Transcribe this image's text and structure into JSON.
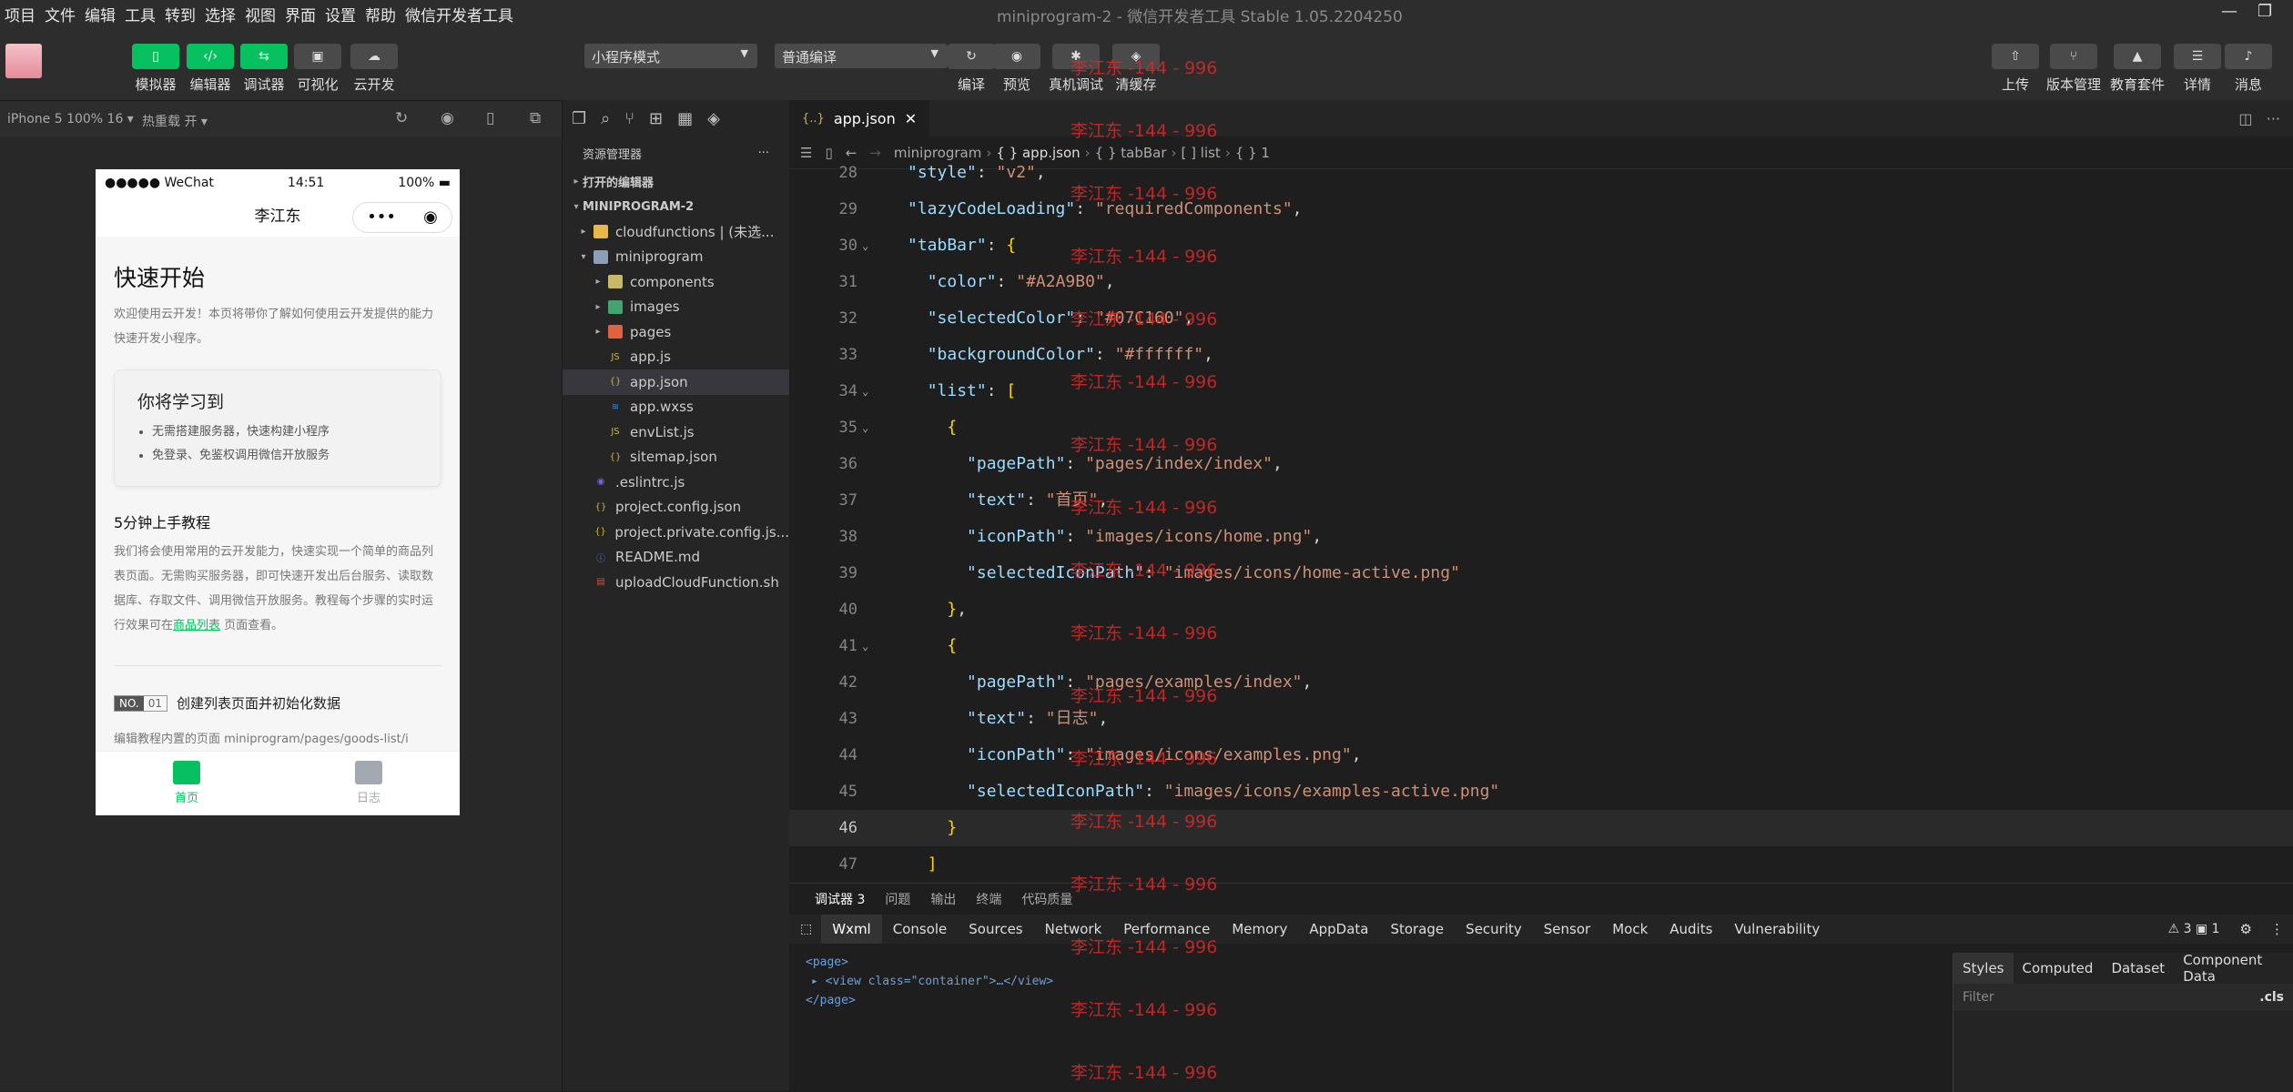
{
  "menu": [
    "项目",
    "文件",
    "编辑",
    "工具",
    "转到",
    "选择",
    "视图",
    "界面",
    "设置",
    "帮助",
    "微信开发者工具"
  ],
  "window_title": "miniprogram-2 - 微信开发者工具 Stable 1.05.2204250",
  "toolbar": {
    "left": [
      {
        "label": "模拟器",
        "icon": "phone-icon"
      },
      {
        "label": "编辑器",
        "icon": "code-icon"
      },
      {
        "label": "调试器",
        "icon": "debug-icon"
      },
      {
        "label": "可视化",
        "icon": "layout-icon"
      },
      {
        "label": "云开发",
        "icon": "cloud-icon"
      }
    ],
    "mode": "小程序模式",
    "compile": "普通编译",
    "mid": [
      {
        "label": "编译",
        "icon": "refresh-icon"
      },
      {
        "label": "预览",
        "icon": "eye-icon"
      },
      {
        "label": "真机调试",
        "icon": "bug-icon"
      },
      {
        "label": "清缓存",
        "icon": "layers-icon"
      }
    ],
    "right": [
      {
        "label": "上传",
        "icon": "upload-icon"
      },
      {
        "label": "版本管理",
        "icon": "branch-icon"
      },
      {
        "label": "教育套件",
        "icon": "graduation-icon"
      },
      {
        "label": "详情",
        "icon": "menu-icon"
      },
      {
        "label": "消息",
        "icon": "bell-icon"
      }
    ]
  },
  "simulator": {
    "device": "iPhone 5 100% 16 ▾",
    "hotreload": "热重载 开 ▾",
    "status": {
      "signal": "●●●●● WeChat",
      "time": "14:51",
      "battery": "100%"
    },
    "nav_title": "李江东",
    "page": {
      "title": "快速开始",
      "intro": "欢迎使用云开发！本页将带你了解如何使用云开发提供的能力快速开发小程序。",
      "card_title": "你将学习到",
      "card_items": [
        "无需搭建服务器，快速构建小程序",
        "免登录、免鉴权调用微信开放服务"
      ],
      "section_title": "5分钟上手教程",
      "section_text": "我们将会使用常用的云开发能力，快速实现一个简单的商品列表页面。无需购买服务器，即可快速开发出后台服务、读取数据库、存取文件、调用微信开放服务。教程每个步骤的实时运行效果可在",
      "section_link": "商品列表",
      "section_tail": " 页面查看。",
      "step_no": "NO.",
      "step_num": "01",
      "step_title": "创建列表页面并初始化数据",
      "step_desc": "编辑教程内置的页面 miniprogram/pages/goods-list/i"
    },
    "tabs": [
      {
        "label": "首页"
      },
      {
        "label": "日志"
      }
    ]
  },
  "explorer": {
    "title": "资源管理器",
    "section_open": "打开的编辑器",
    "section_project": "MINIPROGRAM-2",
    "items": [
      {
        "name": "cloudfunctions | (未选...",
        "indent": 1,
        "chev": "▸",
        "icon": "folder-icon",
        "color": "#e8b84a"
      },
      {
        "name": "miniprogram",
        "indent": 1,
        "chev": "▾",
        "icon": "folder-icon",
        "color": "#8aa0b8"
      },
      {
        "name": "components",
        "indent": 2,
        "chev": "▸",
        "icon": "folder-icon",
        "color": "#c7b86a"
      },
      {
        "name": "images",
        "indent": 2,
        "chev": "▸",
        "icon": "folder-icon",
        "color": "#45a36f"
      },
      {
        "name": "pages",
        "indent": 2,
        "chev": "▸",
        "icon": "folder-icon",
        "color": "#e0623e"
      },
      {
        "name": "app.js",
        "indent": 2,
        "chev": "",
        "icon": "js-icon",
        "color": "#cbb34a"
      },
      {
        "name": "app.json",
        "indent": 2,
        "chev": "",
        "icon": "json-icon",
        "color": "#cbb34a",
        "selected": true
      },
      {
        "name": "app.wxss",
        "indent": 2,
        "chev": "",
        "icon": "css-icon",
        "color": "#3c8fd8"
      },
      {
        "name": "envList.js",
        "indent": 2,
        "chev": "",
        "icon": "js-icon",
        "color": "#cbb34a"
      },
      {
        "name": "sitemap.json",
        "indent": 2,
        "chev": "",
        "icon": "json-icon",
        "color": "#cbb34a"
      },
      {
        "name": ".eslintrc.js",
        "indent": 1,
        "chev": "",
        "icon": "eslint-icon",
        "color": "#6e6ad8"
      },
      {
        "name": "project.config.json",
        "indent": 1,
        "chev": "",
        "icon": "json-icon",
        "color": "#cbb34a"
      },
      {
        "name": "project.private.config.js...",
        "indent": 1,
        "chev": "",
        "icon": "json-icon",
        "color": "#cbb34a"
      },
      {
        "name": "README.md",
        "indent": 1,
        "chev": "",
        "icon": "info-icon",
        "color": "#4a8fd8"
      },
      {
        "name": "uploadCloudFunction.sh",
        "indent": 1,
        "chev": "",
        "icon": "shell-icon",
        "color": "#d0503a"
      }
    ]
  },
  "editor": {
    "tab": "app.json",
    "breadcrumb": [
      "miniprogram",
      "{ } app.json",
      "{ } tabBar",
      "[ ] list",
      "{ } 1"
    ],
    "lines": [
      {
        "n": "28",
        "text": "\"style\": \"v2\","
      },
      {
        "n": "29",
        "text": "\"lazyCodeLoading\": \"requiredComponents\","
      },
      {
        "n": "30",
        "text": "\"tabBar\": {",
        "fold": true
      },
      {
        "n": "31",
        "text": "  \"color\": \"#A2A9B0\","
      },
      {
        "n": "32",
        "text": "  \"selectedColor\": \"#07C160\","
      },
      {
        "n": "33",
        "text": "  \"backgroundColor\": \"#ffffff\","
      },
      {
        "n": "34",
        "text": "  \"list\": [",
        "fold": true
      },
      {
        "n": "35",
        "text": "    {",
        "fold": true
      },
      {
        "n": "36",
        "text": "      \"pagePath\": \"pages/index/index\","
      },
      {
        "n": "37",
        "text": "      \"text\": \"首页\","
      },
      {
        "n": "38",
        "text": "      \"iconPath\": \"images/icons/home.png\","
      },
      {
        "n": "39",
        "text": "      \"selectedIconPath\": \"images/icons/home-active.png\""
      },
      {
        "n": "40",
        "text": "    },"
      },
      {
        "n": "41",
        "text": "    {",
        "fold": true
      },
      {
        "n": "42",
        "text": "      \"pagePath\": \"pages/examples/index\","
      },
      {
        "n": "43",
        "text": "      \"text\": \"日志\","
      },
      {
        "n": "44",
        "text": "      \"iconPath\": \"images/icons/examples.png\","
      },
      {
        "n": "45",
        "text": "      \"selectedIconPath\": \"images/icons/examples-active.png\""
      },
      {
        "n": "46",
        "text": "    }",
        "current": true
      },
      {
        "n": "47",
        "text": "  ]"
      }
    ],
    "watermark": "李江东 -144 - 996"
  },
  "devtools": {
    "top_tabs": [
      {
        "label": "调试器 3"
      },
      {
        "label": "问题"
      },
      {
        "label": "输出"
      },
      {
        "label": "终端"
      },
      {
        "label": "代码质量"
      }
    ],
    "tabs": [
      "Wxml",
      "Console",
      "Sources",
      "Network",
      "Performance",
      "Memory",
      "AppData",
      "Storage",
      "Security",
      "Sensor",
      "Mock",
      "Audits",
      "Vulnerability"
    ],
    "warnings": "⚠ 3  ▣ 1",
    "dom": [
      "<page>",
      "▸ <view class=\"container\">…</view>",
      "</page>"
    ],
    "style_tabs": [
      "Styles",
      "Computed",
      "Dataset",
      "Component Data"
    ],
    "filter": "Filter",
    "cls": ".cls"
  }
}
